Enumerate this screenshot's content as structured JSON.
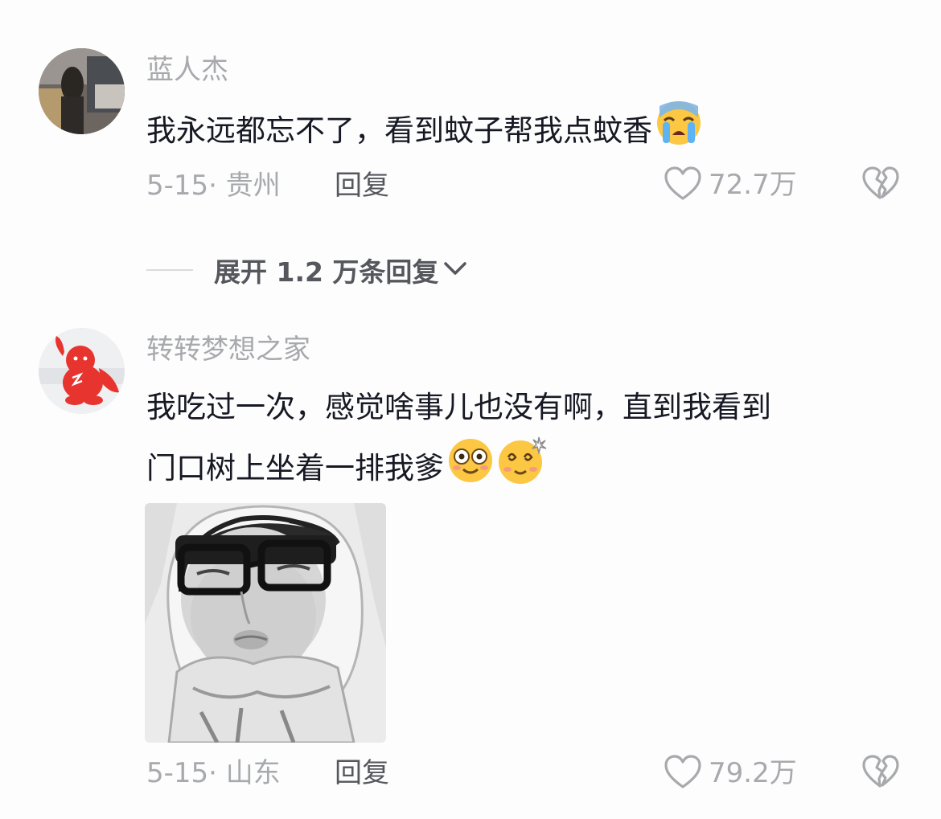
{
  "comments": [
    {
      "username": "蓝人杰",
      "text": "我永远都忘不了，看到蚊子帮我点蚊香",
      "emojis": [
        "crying-emoji"
      ],
      "date_location": "5-15· 贵州",
      "reply_label": "回复",
      "likes": "72.7万"
    },
    {
      "username": "转转梦想之家",
      "text_line1": "我吃过一次，感觉啥事儿也没有啊，直到我看到",
      "text_line2": "门口树上坐着一排我爹",
      "emojis": [
        "goggle-eyed-emoji",
        "dizzy-emoji"
      ],
      "image_alt": "black-and-white photo of a man wearing glasses and a knit hood",
      "date_location": "5-15· 山东",
      "reply_label": "回复",
      "likes": "79.2万"
    }
  ],
  "expand_replies_label": "展开 1.2 万条回复",
  "colors": {
    "background": "#fdfdfd",
    "username": "#a7a9ad",
    "text": "#161823",
    "secondary": "#55575d"
  }
}
